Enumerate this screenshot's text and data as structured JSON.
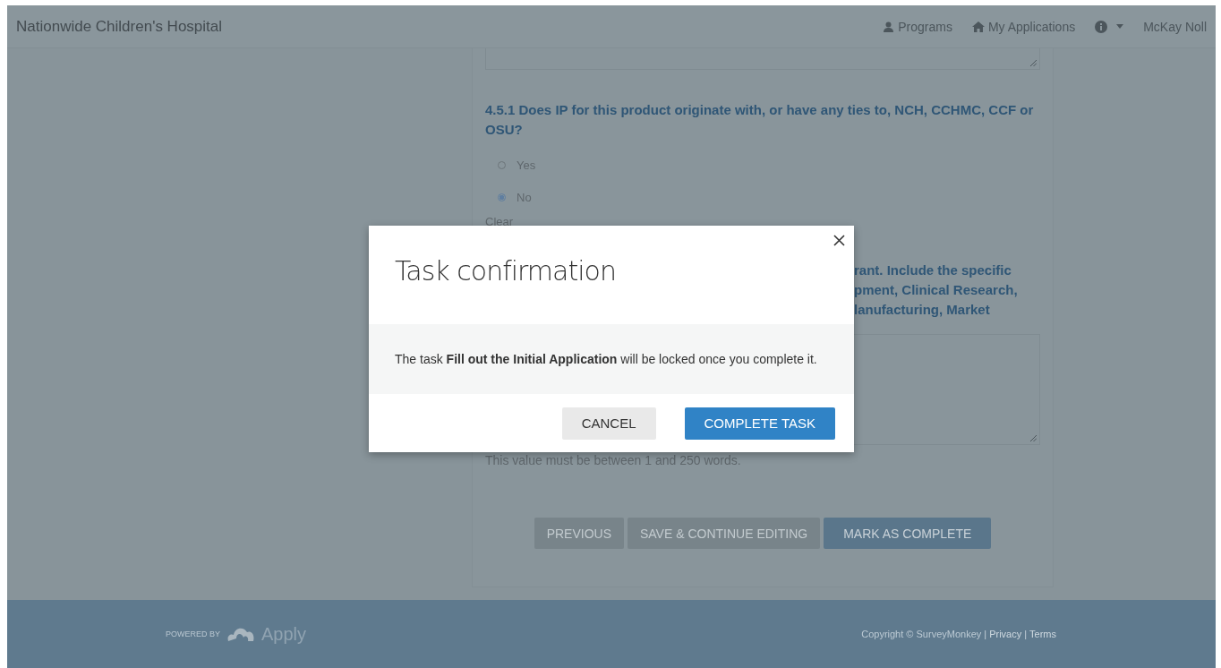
{
  "header": {
    "brand": "Nationwide Children's Hospital",
    "nav": [
      {
        "kind": "link",
        "label": "Programs"
      },
      {
        "kind": "link",
        "label": "My Applications"
      },
      {
        "kind": "menu"
      },
      {
        "kind": "menu",
        "label": "McKay Noll"
      }
    ]
  },
  "form": {
    "question": "4.5.1 Does IP for this product originate with, or have any ties to, NCH, CCHMC, CCF or OSU?",
    "options": [
      {
        "label": "Yes",
        "selected": false
      },
      {
        "label": "No",
        "selected": true
      }
    ],
    "clear": "Clear",
    "next_question_visible": [
      "rant. Include the specific",
      "pment, Clinical Research,",
      "lanufacturing, Market"
    ],
    "hint": "This value must be between 1 and 250 words.",
    "buttons": [
      {
        "label": "PREVIOUS",
        "kind": "secondary"
      },
      {
        "label": "SAVE & CONTINUE EDITING",
        "kind": "secondary"
      },
      {
        "label": "MARK AS COMPLETE",
        "kind": "primary"
      }
    ]
  },
  "modal": {
    "title": "Task confirmation",
    "message": "The task **Fill out the Initial Application** will be locked once you complete it.",
    "buttons": [
      {
        "label": "CANCEL",
        "kind": "secondary"
      },
      {
        "label": "COMPLETE TASK",
        "kind": "primary"
      }
    ]
  },
  "footer": {
    "powered_by": "POWERED BY",
    "logo": "Apply",
    "links": [
      {
        "kind": "text",
        "label": "Copyright © SurveyMonkey"
      },
      {
        "kind": "sep",
        "label": "|"
      },
      {
        "kind": "link",
        "label": "Privacy"
      },
      {
        "kind": "sep",
        "label": "|"
      },
      {
        "kind": "link",
        "label": "Terms"
      }
    ]
  }
}
